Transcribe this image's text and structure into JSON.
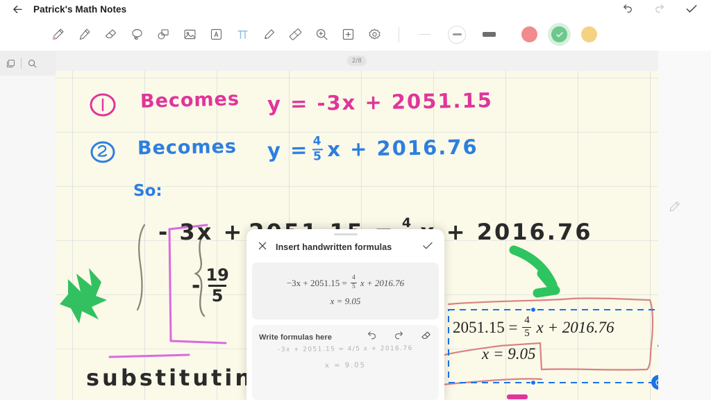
{
  "titlebar": {
    "back_icon": "back-arrow-icon",
    "title": "Patrick's Math Notes",
    "undo_icon": "undo-icon",
    "redo_icon": "redo-icon",
    "confirm_icon": "check-icon"
  },
  "toolbar": {
    "tools": [
      {
        "name": "pen-tool",
        "label": "Pen"
      },
      {
        "name": "highlighter-tool",
        "label": "Highlighter"
      },
      {
        "name": "eraser-tool",
        "label": "Eraser"
      },
      {
        "name": "lasso-tool",
        "label": "Lasso select"
      },
      {
        "name": "shape-tool",
        "label": "Shapes"
      },
      {
        "name": "image-tool",
        "label": "Insert image"
      },
      {
        "name": "text-tool",
        "label": "Text box"
      },
      {
        "name": "formula-tool",
        "label": "Insert formula",
        "active": true
      },
      {
        "name": "marker-tool",
        "label": "Marker"
      },
      {
        "name": "ruler-tool",
        "label": "Ruler"
      },
      {
        "name": "zoom-tool",
        "label": "Zoom"
      },
      {
        "name": "add-page-tool",
        "label": "Add page"
      },
      {
        "name": "settings-tool",
        "label": "Settings"
      }
    ],
    "stroke_widths": [
      {
        "name": "stroke-width-thin",
        "selected": false
      },
      {
        "name": "stroke-width-medium",
        "selected": true
      },
      {
        "name": "stroke-width-thick",
        "selected": false
      }
    ],
    "colors": [
      {
        "name": "color-swatch-red",
        "hex": "#f28b8b",
        "selected": false
      },
      {
        "name": "color-swatch-green",
        "hex": "#6ec88c",
        "selected": true
      },
      {
        "name": "color-swatch-yellow",
        "hex": "#f5d182",
        "selected": false
      }
    ]
  },
  "sidebar": {
    "pages_icon": "pages-icon",
    "search_icon": "search-icon"
  },
  "right_edge": {
    "pencil_icon": "pencil-icon"
  },
  "canvas": {
    "page_indicator": "2/8",
    "notes": {
      "marker_1": "1",
      "becomes_1": "Becomes",
      "marker_2": "2",
      "becomes_2": "Becomes",
      "so_label": "So:",
      "equation_1": "y = -3x + 2051.15",
      "equation_2_lhs": "y =",
      "equation_2_num": "4",
      "equation_2_den": "5",
      "equation_2_rhs": "x + 2016.76",
      "main_line_left": "- 3x +",
      "main_line_mid": "2051.15 =",
      "main_line_num": "4",
      "main_line_den": "5",
      "main_line_right": "x + 2016.76",
      "fraction_num": "19",
      "fraction_den": "5",
      "fraction_sign": "-",
      "substituting": "substitutin"
    },
    "inserted_formula": {
      "line1_lhs": "2051.15 =",
      "line1_num": "4",
      "line1_den": "5",
      "line1_rhs": "x + 2016.76",
      "line2": "x = 9.05",
      "rotate_icon": "rotate-handle-icon"
    },
    "ink_colors": {
      "pink": "#e0359a",
      "blue": "#2d7fe0",
      "black": "#2a2a2a",
      "green": "#22bb55",
      "magenta": "#d96ae0",
      "red_outline": "#d98282",
      "grey": "#8a8375"
    }
  },
  "dialog": {
    "close_icon": "close-icon",
    "title": "Insert handwritten formulas",
    "confirm_icon": "check-icon",
    "preview": {
      "line1_lhs": "−3x + 2051.15 =",
      "line1_num": "4",
      "line1_den": "5",
      "line1_rhs": "x + 2016.76",
      "line2": "x = 9.05"
    },
    "write_placeholder": "Write formulas here",
    "undo_icon": "undo-icon",
    "redo_icon": "redo-icon",
    "eraser_icon": "eraser-icon",
    "handwriting_line1": "-3x + 2051.15 = 4/5 x + 2016.76",
    "handwriting_line2": "x = 9.05"
  }
}
